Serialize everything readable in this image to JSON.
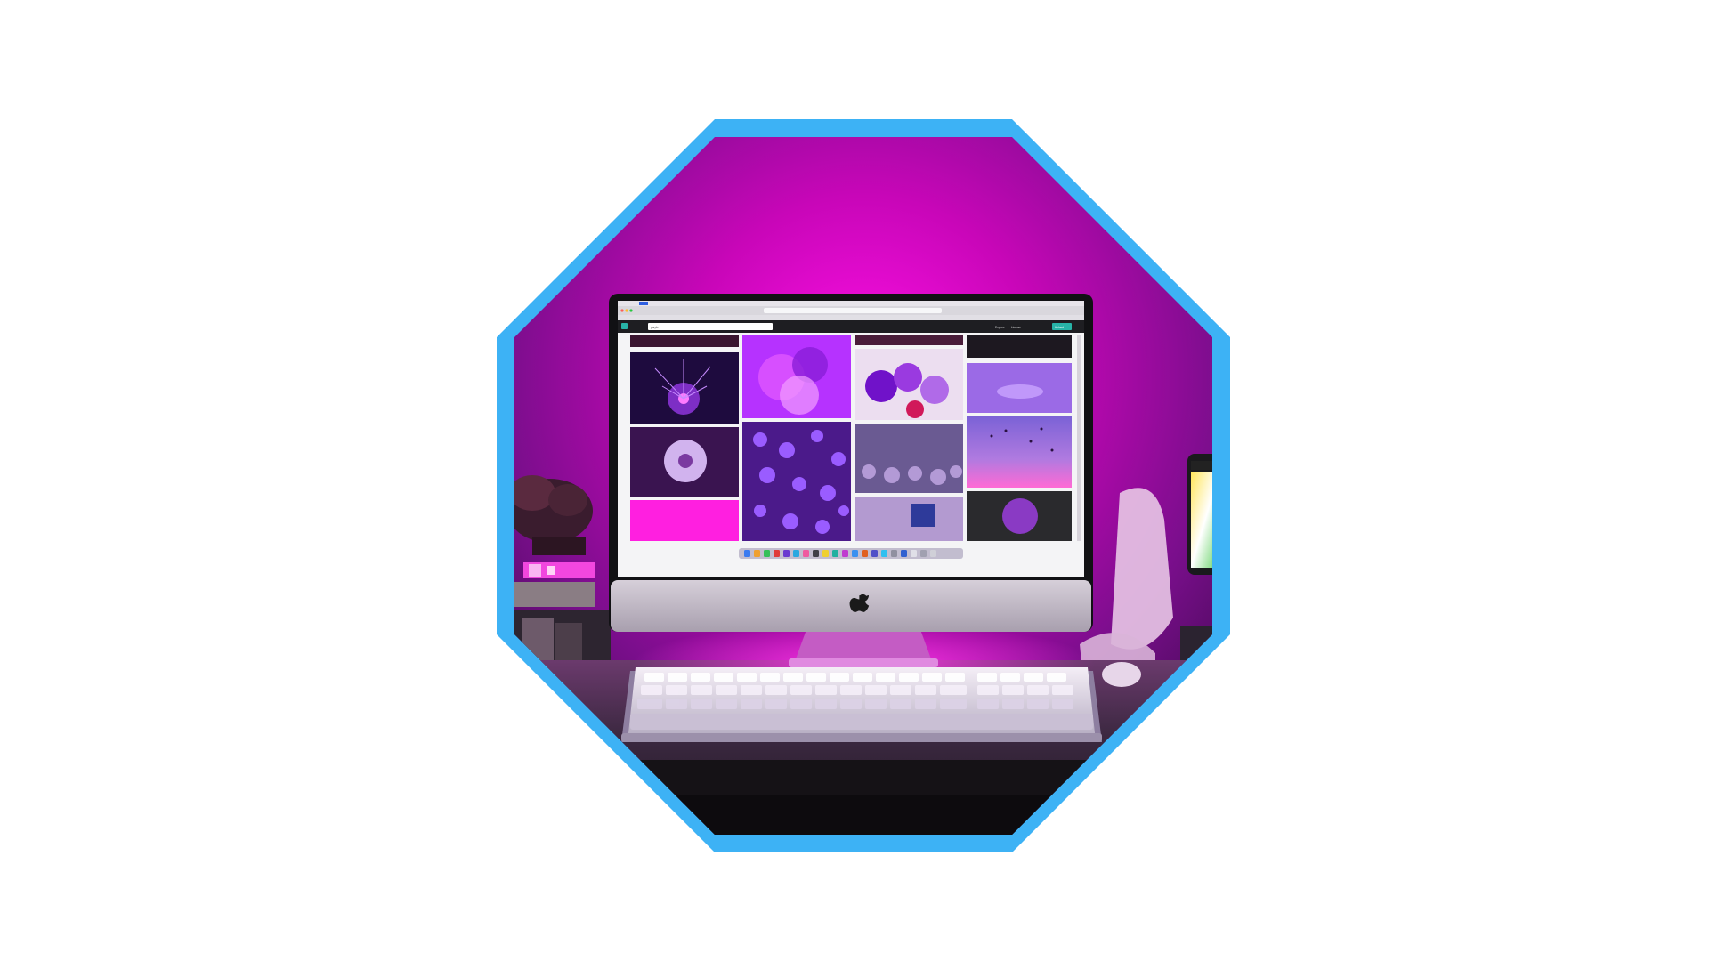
{
  "image": {
    "subject": "desktop computer setup with magenta backlighting",
    "frame_shape": "octagon",
    "colors": {
      "page_background": "#ffffff",
      "frame_border": "#3db2f5",
      "wall_glow": "#e800d6",
      "wall_dark": "#5c0a78",
      "desk": "#2a1f2b",
      "monitor_bezel": "#111114",
      "monitor_chin": "#c9c1cc",
      "keyboard": "#e9e2ee"
    },
    "screen": {
      "browser_tabs": "",
      "search_query": "purple",
      "header_actions": [
        "Explore",
        "License",
        "Upload"
      ],
      "dock": "macOS dock"
    },
    "icons": [
      "apple-logo-icon"
    ]
  }
}
